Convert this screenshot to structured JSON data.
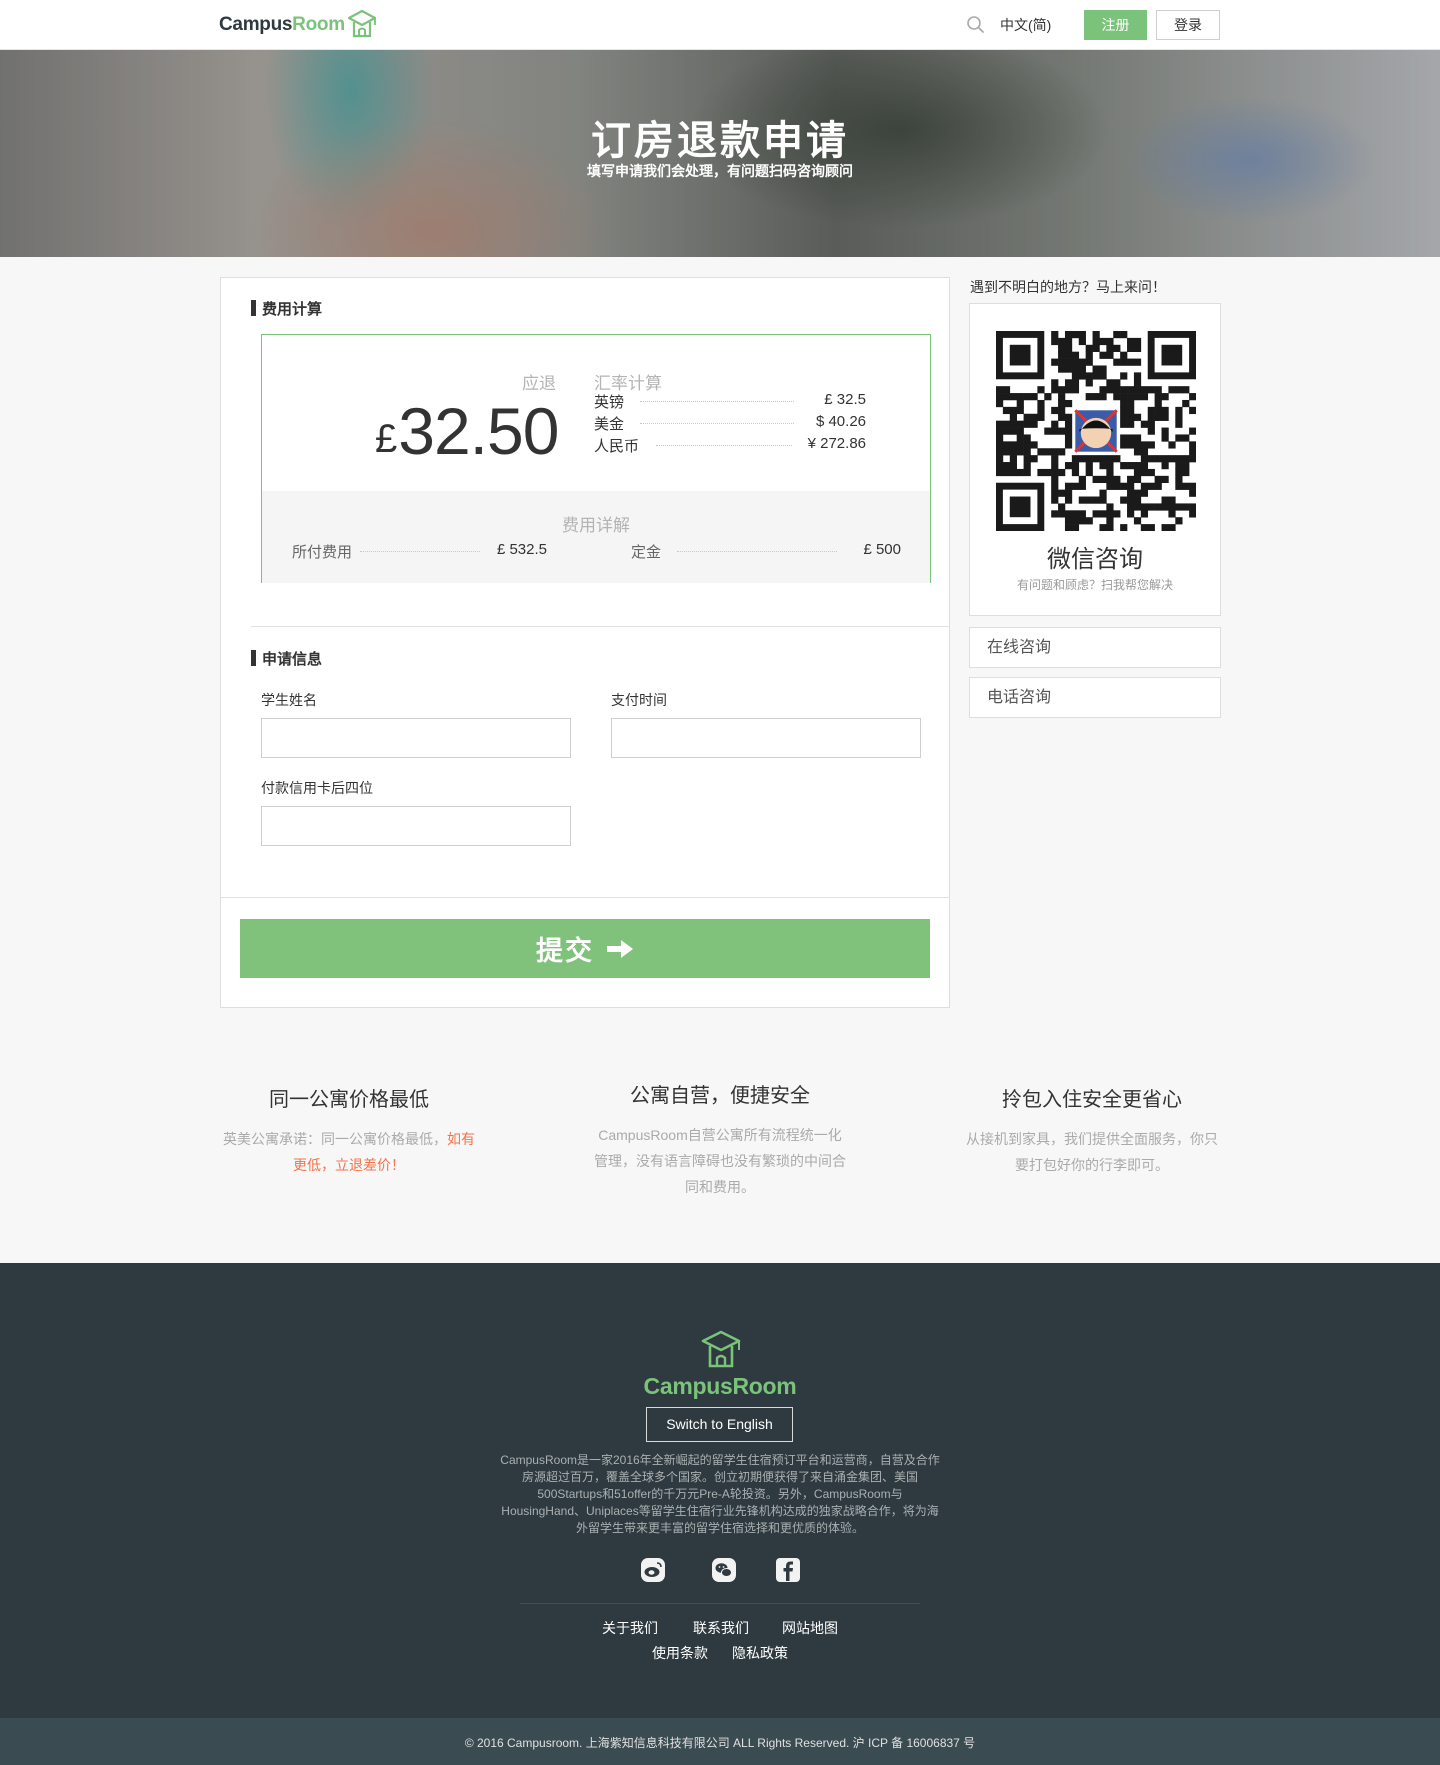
{
  "header": {
    "logo_part1": "Campus",
    "logo_part2": "Room",
    "lang": "中文(简)",
    "register": "注册",
    "login": "登录"
  },
  "hero": {
    "title": "订房退款申请",
    "subtitle": "填写申请我们会处理，有问题扫码咨询顾问"
  },
  "fee": {
    "section_title": "费用计算",
    "refund_label": "应退",
    "currency_symbol": "£",
    "refund_amount": "32.50",
    "rate_title": "汇率计算",
    "rates": [
      {
        "name": "英镑",
        "value": "£ 32.5"
      },
      {
        "name": "美金",
        "value": "$ 40.26"
      },
      {
        "name": "人民币",
        "value": "¥ 272.86"
      }
    ],
    "detail_title": "费用详解",
    "details": [
      {
        "name": "所付费用",
        "value": "£ 532.5"
      },
      {
        "name": "定金",
        "value": "£ 500"
      }
    ]
  },
  "form": {
    "section_title": "申请信息",
    "student_name_label": "学生姓名",
    "student_name_value": "",
    "pay_time_label": "支付时间",
    "pay_time_value": "",
    "card_last4_label": "付款信用卡后四位",
    "card_last4_value": "",
    "submit_label": "提交"
  },
  "side": {
    "hint": "遇到不明白的地方？马上来问！",
    "qr_title": "微信咨询",
    "qr_subtitle": "有问题和顾虑？扫我帮您解决",
    "online_consult": "在线咨询",
    "phone_consult": "电话咨询"
  },
  "features": [
    {
      "title": "同一公寓价格最低",
      "desc_plain": "英美公寓承诺：同一公寓价格最低，",
      "desc_highlight": "如有更低，立退差价！"
    },
    {
      "title": "公寓自营，便捷安全",
      "desc_plain": "CampusRoom自营公寓所有流程统一化管理，没有语言障碍也没有繁琐的中间合同和费用。",
      "desc_highlight": ""
    },
    {
      "title": "拎包入住安全更省心",
      "desc_plain": "从接机到家具，我们提供全面服务，你只要打包好你的行李即可。",
      "desc_highlight": ""
    }
  ],
  "footer": {
    "logo": "CampusRoom",
    "switch_language": "Switch to English",
    "about": "CampusRoom是一家2016年全新崛起的留学生住宿预订平台和运营商，自营及合作房源超过百万，覆盖全球多个国家。创立初期便获得了来自涌金集团、美国500Startups和51offer的千万元Pre-A轮投资。另外，CampusRoom与HousingHand、Uniplaces等留学生住宿行业先锋机构达成的独家战略合作，将为海外留学生带来更丰富的留学住宿选择和更优质的体验。",
    "social_icons": [
      "weibo-icon",
      "wechat-icon",
      "facebook-icon"
    ],
    "links": [
      "关于我们",
      "联系我们",
      "网站地图",
      "使用条款",
      "隐私政策"
    ],
    "copyright": "© 2016 Campusroom. 上海紫知信息科技有限公司 ALL Rights Reserved. 沪 ICP 备 16006837 号"
  },
  "colors": {
    "brand_green": "#7bc27a",
    "highlight_orange": "#f0744b",
    "footer_bg": "#2e3a3f"
  }
}
